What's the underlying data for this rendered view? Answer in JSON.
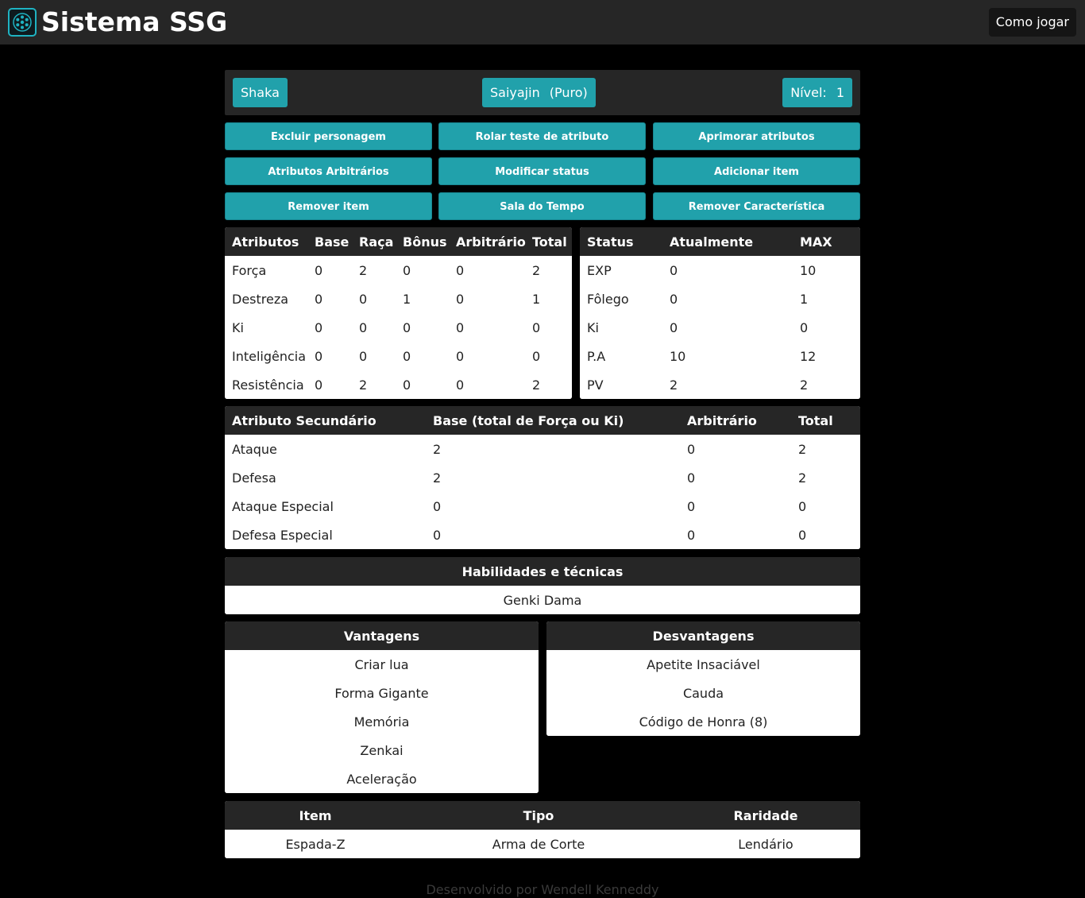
{
  "app": {
    "title": "Sistema SSG",
    "logo_icon": "wheel-icon",
    "howto_label": "Como jogar"
  },
  "character": {
    "name": "Shaka",
    "race": "Saiyajin",
    "race_variant": "(Puro)",
    "level_label": "Nível:",
    "level_value": "1"
  },
  "actions": [
    "Excluir personagem",
    "Rolar teste de atributo",
    "Aprimorar atributos",
    "Atributos Arbitrários",
    "Modificar status",
    "Adicionar item",
    "Remover item",
    "Sala do Tempo",
    "Remover Característica"
  ],
  "attributes": {
    "headers": [
      "Atributos",
      "Base",
      "Raça",
      "Bônus",
      "Arbitrário",
      "Total"
    ],
    "rows": [
      [
        "Força",
        "0",
        "2",
        "0",
        "0",
        "2"
      ],
      [
        "Destreza",
        "0",
        "0",
        "1",
        "0",
        "1"
      ],
      [
        "Ki",
        "0",
        "0",
        "0",
        "0",
        "0"
      ],
      [
        "Inteligência",
        "0",
        "0",
        "0",
        "0",
        "0"
      ],
      [
        "Resistência",
        "0",
        "2",
        "0",
        "0",
        "2"
      ]
    ]
  },
  "status": {
    "headers": [
      "Status",
      "Atualmente",
      "MAX"
    ],
    "rows": [
      [
        "EXP",
        "0",
        "10"
      ],
      [
        "Fôlego",
        "0",
        "1"
      ],
      [
        "Ki",
        "0",
        "0"
      ],
      [
        "P.A",
        "10",
        "12"
      ],
      [
        "PV",
        "2",
        "2"
      ]
    ]
  },
  "secondary": {
    "headers": [
      "Atributo Secundário",
      "Base (total de Força ou Ki)",
      "Arbitrário",
      "Total"
    ],
    "rows": [
      [
        "Ataque",
        "2",
        "0",
        "2"
      ],
      [
        "Defesa",
        "2",
        "0",
        "2"
      ],
      [
        "Ataque Especial",
        "0",
        "0",
        "0"
      ],
      [
        "Defesa Especial",
        "0",
        "0",
        "0"
      ]
    ]
  },
  "skills": {
    "header": "Habilidades e técnicas",
    "items": [
      "Genki Dama"
    ]
  },
  "advantages": {
    "header": "Vantagens",
    "items": [
      "Criar lua",
      "Forma Gigante",
      "Memória",
      "Zenkai",
      "Aceleração"
    ]
  },
  "disadvantages": {
    "header": "Desvantagens",
    "items": [
      "Apetite Insaciável",
      "Cauda",
      "Código de Honra (8)"
    ]
  },
  "items": {
    "headers": [
      "Item",
      "Tipo",
      "Raridade"
    ],
    "rows": [
      [
        "Espada-Z",
        "Arma de Corte",
        "Lendário"
      ]
    ]
  },
  "footer": "Desenvolvido por Wendell Kenneddy"
}
